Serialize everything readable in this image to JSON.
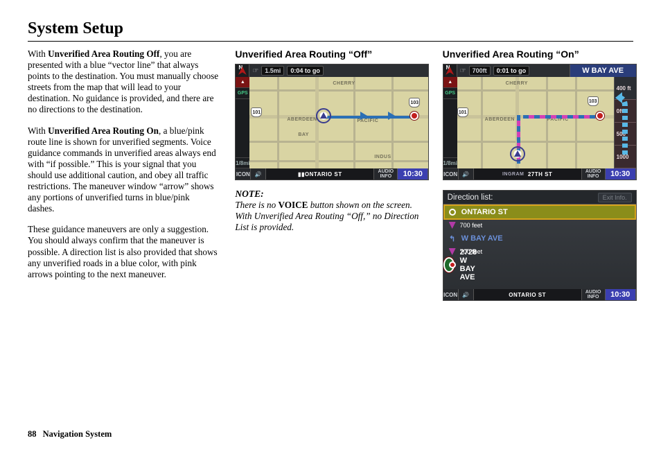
{
  "page": {
    "title": "System Setup",
    "page_number": "88",
    "doc_title": "Navigation System"
  },
  "col1": {
    "p1_lead_bold": "Unverified Area Routing Off",
    "p1_pre": "With ",
    "p1_rest": ", you are presented with a blue “vector line” that always points to the destination. You must manually choose streets from the map that will lead to your destination. No guidance is provided, and there are no directions to the destination.",
    "p2_pre": "With ",
    "p2_lead_bold": "Unverified Area Routing On",
    "p2_rest": ", a blue/pink route line is shown for unverified segments. Voice guidance commands in unverified areas always end with “if possible.” This is your signal that you should use additional caution, and obey all traffic restrictions. The maneuver window “arrow” shows any portions of unverified turns in blue/pink dashes.",
    "p3": "These guidance maneuvers are only a suggestion. You should always confirm that the maneuver is possible. A direction list is also provided that shows any unverified roads in a blue color, with pink arrows pointing to the next maneuver."
  },
  "col2": {
    "heading": "Unverified Area Routing “Off”",
    "note_label": "NOTE:",
    "note_pre": "There is no ",
    "note_bold": "VOICE",
    "note_post": " button shown on the screen. With Unverified Area Routing “Off,” no Direction List is provided."
  },
  "col3": {
    "heading": "Unverified Area Routing “On”"
  },
  "nav_off": {
    "distance_chip": "1.5mi",
    "eta_chip": "0:04 to go",
    "scale": "1/8mi",
    "gps": "GPS",
    "bottom_street": "ONTARIO ST",
    "audio": "AUDIO INFO",
    "time": "10:30",
    "labels": {
      "cherry": "CHERRY",
      "aberdeen": "ABERDEEN",
      "bay": "BAY",
      "pacific": "PACIFIC",
      "indus": "INDUS"
    },
    "shields": {
      "a": "101",
      "b": "103"
    },
    "icon_label": "ICON"
  },
  "nav_on": {
    "distance_chip": "700ft",
    "eta_chip": "0:01 to go",
    "street_name": "W BAY AVE",
    "scale": "1/8mi",
    "gps": "GPS",
    "bottom_area": "INGRAM",
    "bottom_street": "27TH ST",
    "audio": "AUDIO INFO",
    "time": "10:30",
    "ruler": [
      "400 ft",
      "0ft",
      "500",
      "1000"
    ],
    "labels": {
      "cherry": "CHERRY",
      "aberdeen": "ABERDEEN",
      "pacific": "PACIFIC"
    },
    "shields": {
      "a": "101",
      "b": "103"
    },
    "icon_label": "ICON"
  },
  "dirlist": {
    "header": "Direction list:",
    "exit": "Exit Info.",
    "rows": {
      "r1": "ONTARIO ST",
      "d1": "700 feet",
      "r2": "W BAY AVE",
      "d2": "700 feet",
      "r3": "2728 W BAY AVE"
    },
    "bottom_street": "ONTARIO ST",
    "audio": "AUDIO INFO",
    "time": "10:30",
    "icon_label": "ICON"
  }
}
